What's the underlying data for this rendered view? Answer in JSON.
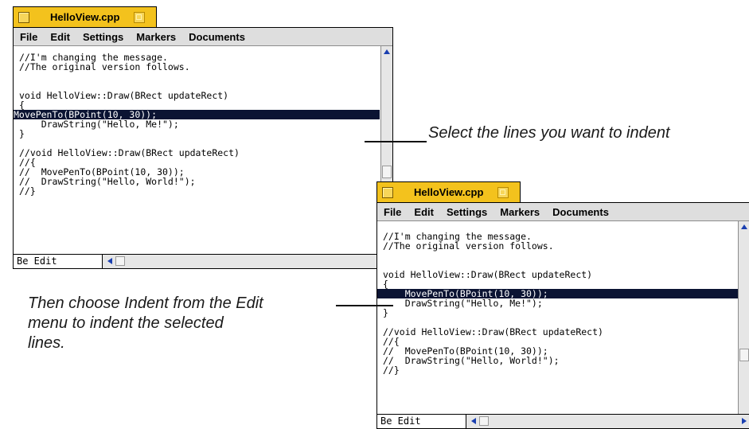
{
  "window1": {
    "title": "HelloView.cpp",
    "menu": [
      "File",
      "Edit",
      "Settings",
      "Markers",
      "Documents"
    ],
    "lines": [
      "//I'm changing the message.",
      "//The original version follows.",
      "",
      "",
      "void HelloView::Draw(BRect updateRect)",
      "{",
      "MovePenTo(BPoint(10, 30));",
      "    DrawString(\"Hello, Me!\");",
      "}",
      "",
      "//void HelloView::Draw(BRect updateRect)",
      "//{",
      "//  MovePenTo(BPoint(10, 30));",
      "//  DrawString(\"Hello, World!\");",
      "//}"
    ],
    "status": "Be Edit"
  },
  "window2": {
    "title": "HelloView.cpp",
    "menu": [
      "File",
      "Edit",
      "Settings",
      "Markers",
      "Documents"
    ],
    "lines": [
      "//I'm changing the message.",
      "//The original version follows.",
      "",
      "",
      "void HelloView::Draw(BRect updateRect)",
      "{",
      "    MovePenTo(BPoint(10, 30));",
      "    DrawString(\"Hello, Me!\");",
      "}",
      "",
      "//void HelloView::Draw(BRect updateRect)",
      "//{",
      "//  MovePenTo(BPoint(10, 30));",
      "//  DrawString(\"Hello, World!\");",
      "//}"
    ],
    "status": "Be Edit"
  },
  "callouts": {
    "select": "Select the lines you want to indent",
    "indent": "Then choose Indent from the Edit\nmenu to indent the selected\nlines."
  }
}
